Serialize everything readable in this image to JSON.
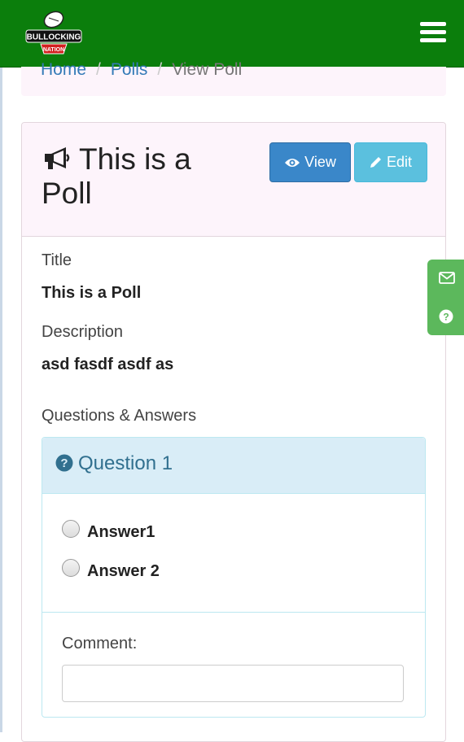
{
  "navbar": {
    "logo_text": "BULLOCKING",
    "logo_subtext": "NATION",
    "menu_icon": "hamburger-menu-icon"
  },
  "breadcrumb": {
    "home": "Home",
    "polls": "Polls",
    "current": "View Poll",
    "separator": "/"
  },
  "poll": {
    "title": "This is a Poll",
    "icon": "megaphone-icon",
    "view_label": "View",
    "edit_label": "Edit",
    "title_label": "Title",
    "title_value": "This is a Poll",
    "description_label": "Description",
    "description_value": "asd fasdf asdf as",
    "qa_label": "Questions & Answers"
  },
  "questions": [
    {
      "title": "Question 1",
      "answers": [
        "Answer1",
        "Answer 2"
      ],
      "comment_label": "Comment:",
      "comment_value": ""
    }
  ],
  "side_tab": {
    "icons": [
      "envelope-icon",
      "question-circle-icon"
    ]
  },
  "colors": {
    "navbar": "#0b7e0c",
    "primary": "#3a87c9",
    "info": "#5bc0de",
    "link": "#337ab7",
    "panel_heading": "#fdf4fb",
    "question_heading": "#d9edf7",
    "side_tab": "#5cb85c"
  }
}
